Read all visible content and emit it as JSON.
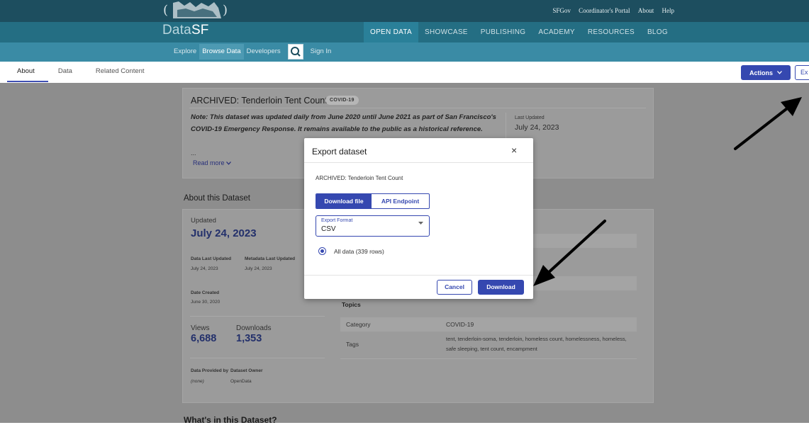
{
  "header": {
    "top_links": [
      "SFGov",
      "Coordinator's Portal",
      "About",
      "Help"
    ],
    "brand_prefix": "Data",
    "brand_suffix": "SF",
    "main_nav": [
      "OPEN DATA",
      "SHOWCASE",
      "PUBLISHING",
      "ACADEMY",
      "RESOURCES",
      "BLOG"
    ],
    "sub_nav": [
      "Explore",
      "Browse Data",
      "Developers",
      "Sign In"
    ]
  },
  "tabs": [
    "About",
    "Data",
    "Related Content"
  ],
  "actions_label": "Actions",
  "export_label": "Ex",
  "dataset": {
    "title": "ARCHIVED: Tenderloin Tent Count",
    "badge": "COVID-19",
    "note": "Note: This dataset was updated daily from June 2020 until June 2021 as part of San Francisco's COVID-19 Emergency Response. It remains available to the public as a historical reference.",
    "ellipsis": "...",
    "read_more": "Read more",
    "last_updated_label": "Last Updated",
    "last_updated_value": "July 24, 2023"
  },
  "about": {
    "heading": "About this Dataset",
    "updated_label": "Updated",
    "updated_value": "July 24, 2023",
    "data_last_updated_label": "Data Last Updated",
    "metadata_last_updated_label": "Metadata Last Updated",
    "data_last_updated_value": "July 24, 2023",
    "metadata_last_updated_value": "July 24, 2023",
    "date_created_label": "Date Created",
    "date_created_value": "June 30, 2020",
    "views_label": "Views",
    "views_value": "6,688",
    "downloads_label": "Downloads",
    "downloads_value": "1,353",
    "provided_by_label": "Data Provided by",
    "provided_by_value": "(none)",
    "owner_label": "Dataset Owner",
    "owner_value": "OpenData",
    "topics_label": "Topics",
    "category_label": "Category",
    "category_value": "COVID-19",
    "tags_label": "Tags",
    "tags_value": "tent, tenderloin-soma, tenderloin, homeless count, homelessness, homeless, safe sleeping, tent count, encampment",
    "whats_heading": "What's in this Dataset?"
  },
  "modal": {
    "title": "Export dataset",
    "close": "×",
    "dataset_name": "ARCHIVED: Tenderloin Tent Count",
    "tab_download": "Download file",
    "tab_api": "API Endpoint",
    "format_label": "Export Format",
    "format_value": "CSV",
    "radio_label": "All data (339 rows)",
    "cancel": "Cancel",
    "download": "Download"
  },
  "colors": {
    "header_dark": "#1d4e5f",
    "header_mid": "#246e83",
    "header_light": "#3a8ba5",
    "accent": "#3548b0"
  },
  "icons": [
    "crest-logo",
    "search-icon",
    "chevron-down-icon",
    "close-icon",
    "caret-down-icon",
    "annotation-arrow"
  ]
}
